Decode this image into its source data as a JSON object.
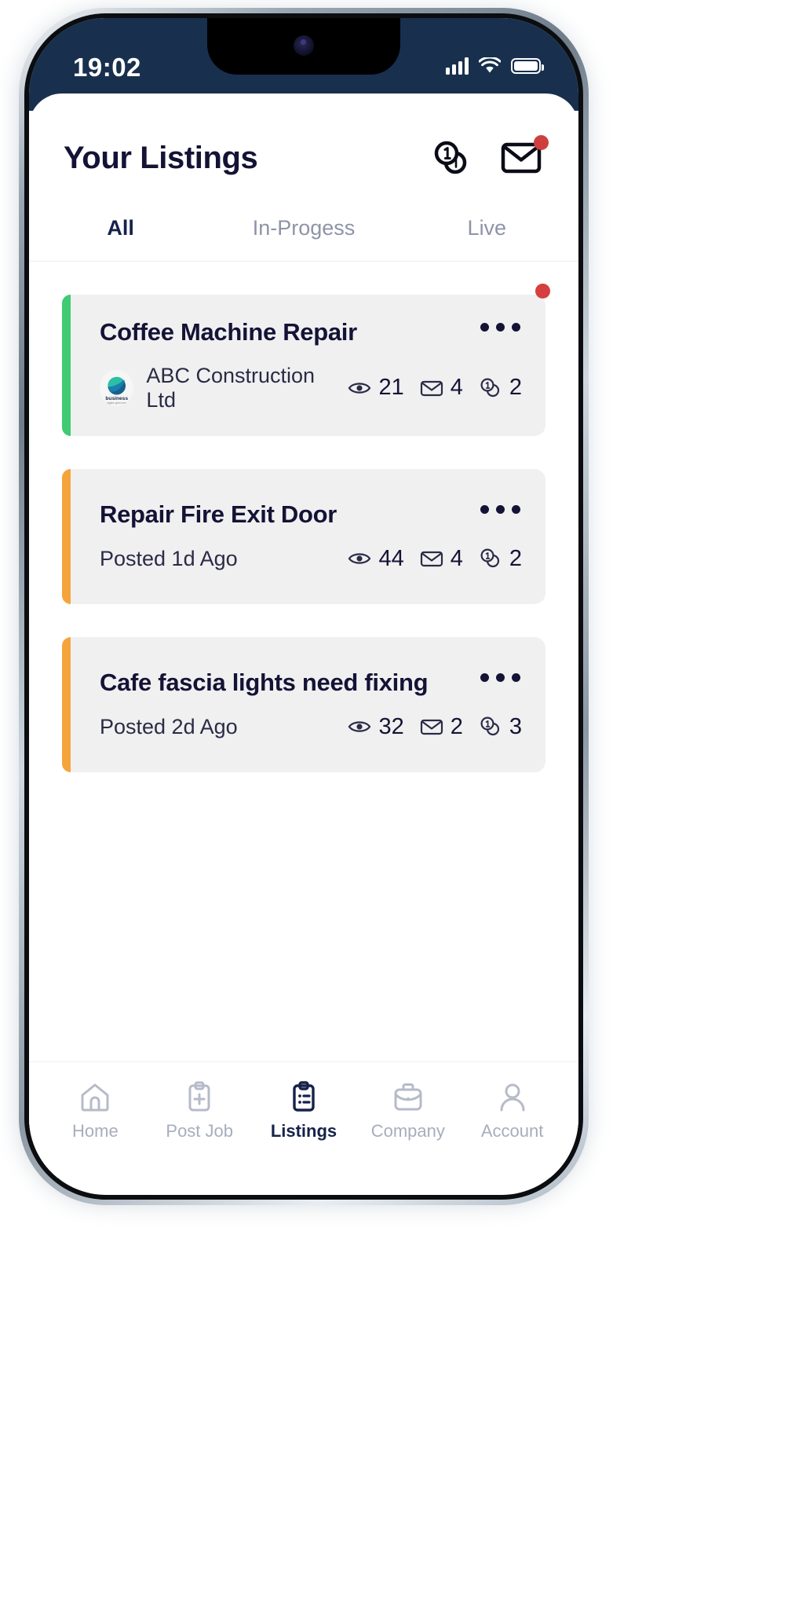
{
  "status_bar": {
    "time": "19:02",
    "signal_icon": "cellular-signal-icon",
    "wifi_icon": "wifi-icon",
    "battery_icon": "battery-icon",
    "background_color": "#18304e"
  },
  "header": {
    "title": "Your Listings",
    "coins_icon": "coins-icon",
    "mail_icon": "mail-icon",
    "mail_badge_color": "#cf3f3f"
  },
  "tabs": [
    {
      "label": "All",
      "active": true
    },
    {
      "label": "In-Progess",
      "active": false
    },
    {
      "label": "Live",
      "active": false
    }
  ],
  "listings": [
    {
      "title": "Coffee Machine Repair",
      "subtitle": "ABC Construction Ltd",
      "subtitle_type": "company",
      "logo_text": "business",
      "logo_tagline": "tagline goes here",
      "accent_color": "#3ecb72",
      "has_badge": true,
      "stats": [
        {
          "icon": "eye-icon",
          "value": "21"
        },
        {
          "icon": "mail-icon",
          "value": "4"
        },
        {
          "icon": "coins-icon",
          "value": "2"
        }
      ],
      "menu_icon": "kebab-menu-icon"
    },
    {
      "title": "Repair Fire Exit Door",
      "subtitle": "Posted 1d Ago",
      "subtitle_type": "posted",
      "accent_color": "#f5a43c",
      "has_badge": false,
      "stats": [
        {
          "icon": "eye-icon",
          "value": "44"
        },
        {
          "icon": "mail-icon",
          "value": "4"
        },
        {
          "icon": "coins-icon",
          "value": "2"
        }
      ],
      "menu_icon": "kebab-menu-icon"
    },
    {
      "title": "Cafe fascia lights need fixing",
      "subtitle": "Posted 2d Ago",
      "subtitle_type": "posted",
      "accent_color": "#f5a43c",
      "has_badge": false,
      "stats": [
        {
          "icon": "eye-icon",
          "value": "32"
        },
        {
          "icon": "mail-icon",
          "value": "2"
        },
        {
          "icon": "coins-icon",
          "value": "3"
        }
      ],
      "menu_icon": "kebab-menu-icon"
    }
  ],
  "bottom_nav": [
    {
      "label": "Home",
      "icon": "home-icon",
      "active": false
    },
    {
      "label": "Post Job",
      "icon": "clipboard-plus-icon",
      "active": false
    },
    {
      "label": "Listings",
      "icon": "clipboard-list-icon",
      "active": true
    },
    {
      "label": "Company",
      "icon": "briefcase-icon",
      "active": false
    },
    {
      "label": "Account",
      "icon": "person-icon",
      "active": false
    }
  ],
  "colors": {
    "navy": "#141335",
    "muted": "#8e93a8",
    "card_bg": "#f0f0f1",
    "green_accent": "#3ecb72",
    "orange_accent": "#f5a43c",
    "red_badge": "#cf3f3f"
  }
}
